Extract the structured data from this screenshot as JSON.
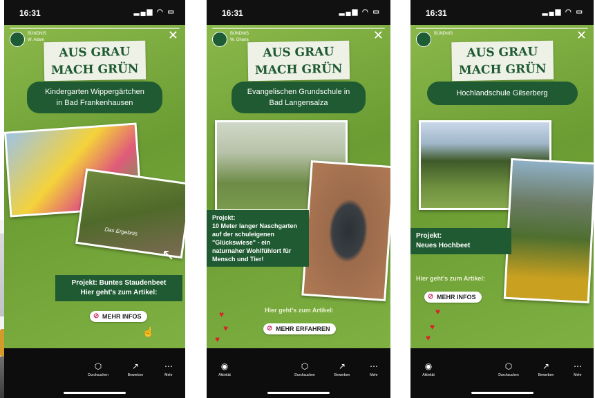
{
  "background_photo": {
    "description_icon": "construction-site-photo"
  },
  "phones": [
    {
      "time": "16:31",
      "account_name": "BÜNDNIS",
      "account_sub": "W. Adam",
      "banner_line1": "AUS GRAU",
      "banner_line2": "MACH GRÜN",
      "school_line1": "Kindergarten Wippergärtchen",
      "school_line2": "in Bad Frankenhausen",
      "photo_caption": "Das Ergebnis",
      "project_line1": "Projekt: Buntes Staudenbeet",
      "project_line2": "Hier geht's zum Artikel:",
      "sticker": "MEHR INFOS",
      "nav": [
        "Durchsuchen",
        "Bewerben",
        "Mehr"
      ]
    },
    {
      "time": "16:31",
      "account_name": "BÜNDNIS",
      "account_sub": "W. Ghana",
      "banner_line1": "AUS GRAU",
      "banner_line2": "MACH GRÜN",
      "school_line1": "Evangelischen Grundschule in",
      "school_line2": "Bad Langensalza",
      "project_text": "Projekt:\n10 Meter langer Naschgarten auf der schuleigenen \"Glückswiese\" - ein naturnaher Wohlfühlort für Mensch und Tier!",
      "link_text": "Hier geht's zum Artikel:",
      "sticker": "MEHR ERFAHREN",
      "nav": [
        "Aktivität",
        "Durchsuchen",
        "Bewerben",
        "Mehr"
      ]
    },
    {
      "time": "16:31",
      "account_name": "BÜNDNIS",
      "banner_line1": "AUS GRAU",
      "banner_line2": "MACH GRÜN",
      "school_line1": "Hochlandschule Gilserberg",
      "project_line1": "Projekt:",
      "project_line2": "Neues Hochbeet",
      "link_text": "Hier geht's zum Artikel:",
      "sticker": "MEHR INFOS",
      "nav": [
        "Aktivität",
        "Durchsuchen",
        "Bewerben",
        "Mehr"
      ]
    }
  ],
  "colors": {
    "brand_green": "#1f5a32",
    "story_green": "#7aab3d",
    "heart": "#d8232a"
  }
}
